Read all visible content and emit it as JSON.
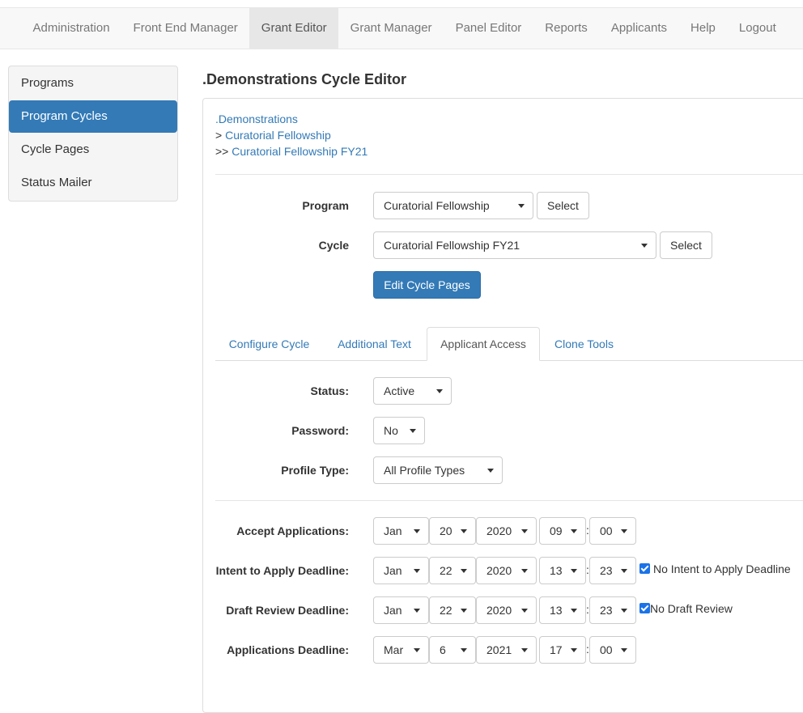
{
  "nav": {
    "items": [
      "Administration",
      "Front End Manager",
      "Grant Editor",
      "Grant Manager",
      "Panel Editor",
      "Reports",
      "Applicants",
      "Help",
      "Logout"
    ],
    "active": "Grant Editor"
  },
  "sidebar": {
    "items": [
      "Programs",
      "Program Cycles",
      "Cycle Pages",
      "Status Mailer"
    ],
    "active": "Program Cycles"
  },
  "page": {
    "title": ".Demonstrations Cycle Editor"
  },
  "breadcrumb": {
    "level1": ".Demonstrations",
    "prefix2": "> ",
    "level2": "Curatorial Fellowship",
    "prefix3": ">> ",
    "level3": "Curatorial Fellowship FY21"
  },
  "selector": {
    "program_label": "Program",
    "program_value": "Curatorial Fellowship",
    "cycle_label": "Cycle",
    "cycle_value": "Curatorial Fellowship FY21",
    "select_label": "Select",
    "edit_pages_label": "Edit Cycle Pages"
  },
  "tabs": {
    "items": [
      "Configure Cycle",
      "Additional Text",
      "Applicant Access",
      "Clone Tools"
    ],
    "active": "Applicant Access"
  },
  "access": {
    "status_label": "Status:",
    "status_value": "Active",
    "password_label": "Password:",
    "password_value": "No",
    "profile_label": "Profile Type:",
    "profile_value": "All Profile Types"
  },
  "dates": {
    "rows": [
      {
        "label": "Accept Applications:",
        "month": "Jan",
        "day": "20",
        "year": "2020",
        "hour": "09",
        "minute": "00",
        "checkbox": ""
      },
      {
        "label": "Intent to Apply Deadline:",
        "month": "Jan",
        "day": "22",
        "year": "2020",
        "hour": "13",
        "minute": "23",
        "checkbox": "No Intent to Apply Deadline",
        "checked": true
      },
      {
        "label": "Draft Review Deadline:",
        "month": "Jan",
        "day": "22",
        "year": "2020",
        "hour": "13",
        "minute": "23",
        "checkbox": "No Draft Review",
        "checked": true
      },
      {
        "label": "Applications Deadline:",
        "month": "Mar",
        "day": "6",
        "year": "2021",
        "hour": "17",
        "minute": "00",
        "checkbox": ""
      }
    ],
    "colon": ":"
  },
  "colors": {
    "primary": "#337ab7",
    "checkbox": "#1a73e8",
    "nav_bg": "#f8f8f8"
  }
}
